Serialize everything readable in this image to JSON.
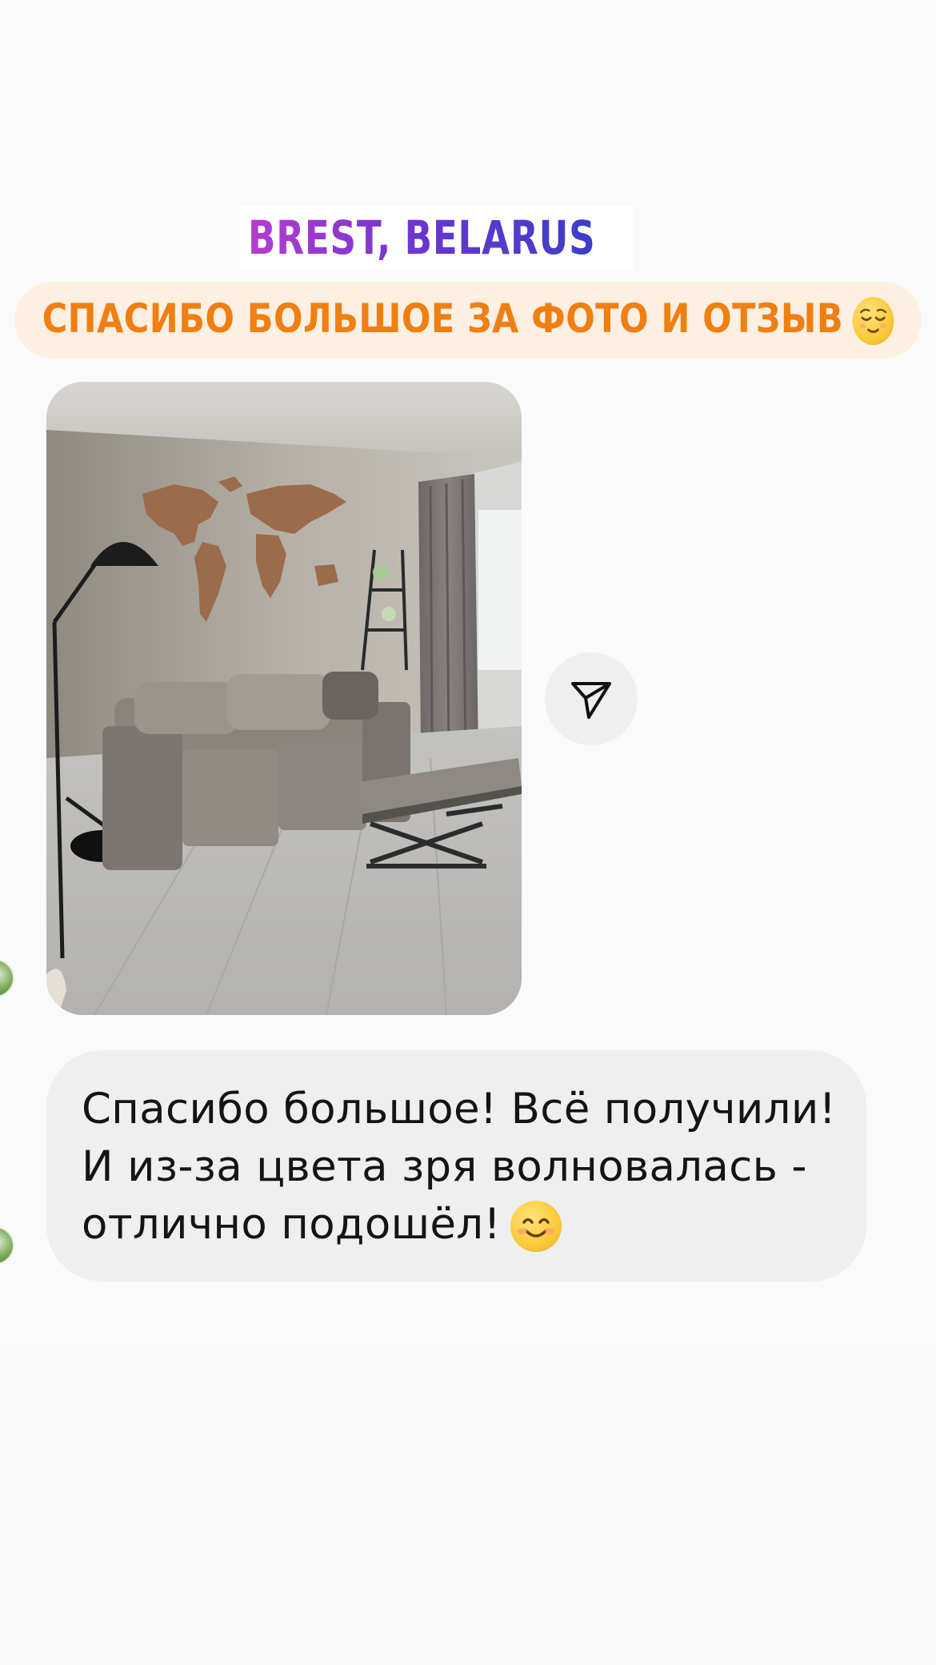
{
  "location_sticker": {
    "text": "BREST, BELARUS",
    "icon": "location-pin-icon",
    "color_start": "#b63ccd",
    "color_end": "#3b3fc9"
  },
  "thanks_sticker": {
    "text": "СПАСИБО БОЛЬШОЕ ЗА ФОТО И ОТЗЫВ",
    "emoji": "relieved-face-emoji",
    "text_color": "#f07f12",
    "background": "#fdefe1"
  },
  "photo": {
    "subject": "living room photo",
    "share_icon": "paper-plane-icon"
  },
  "message": {
    "lines": [
      "Спасибо большое! Всё получили!",
      "И из-за цвета зря волновалась -",
      "отлично подошёл!"
    ],
    "emoji": "smiling-face-emoji",
    "bubble_color": "#efefef"
  },
  "avatars": [
    "sender-avatar",
    "sender-avatar"
  ]
}
